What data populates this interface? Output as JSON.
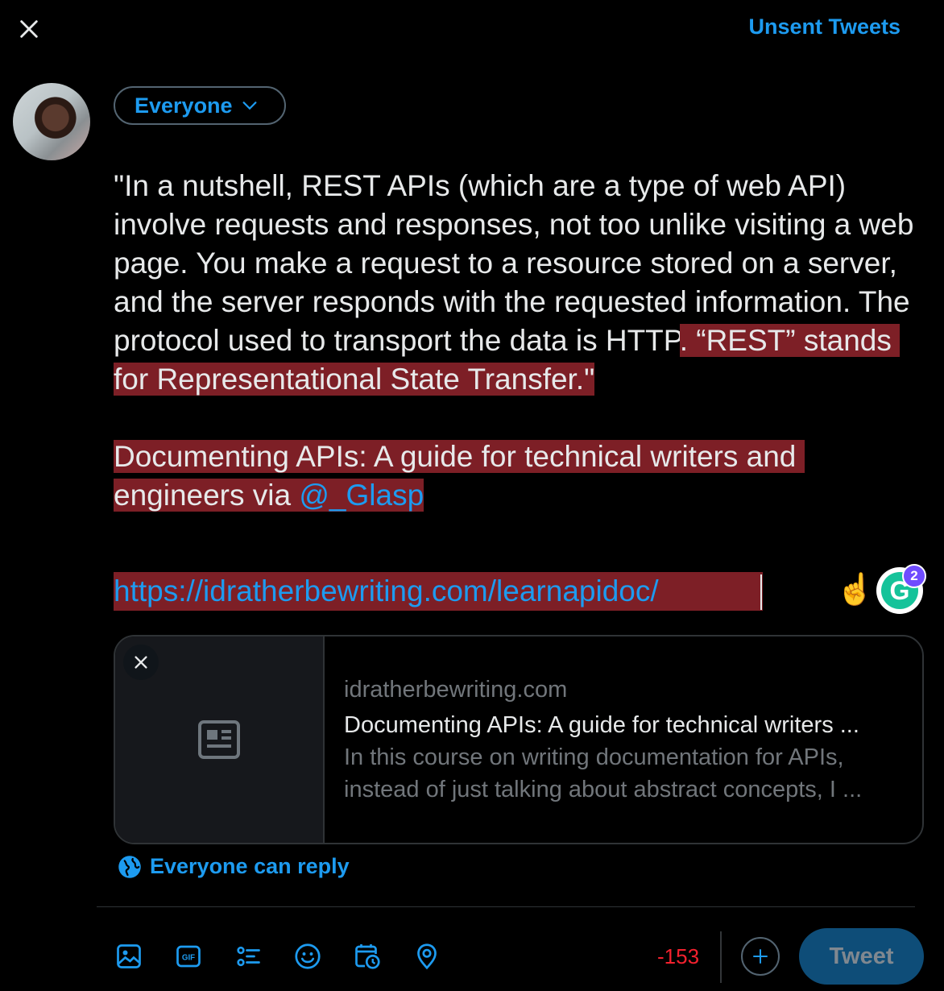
{
  "header": {
    "unsent_label": "Unsent Tweets"
  },
  "composer": {
    "audience_label": "Everyone",
    "text_plain": "\"In a nutshell, REST APIs (which are a type of web API) involve requests and responses, not too unlike visiting a web page. You make a request to a resource stored on a server, and the server responds with the requested information. The protocol used to transport the data is HTTP",
    "text_highlighted": ". “REST” stands for Representational State Transfer.\"",
    "source_line": "Documenting APIs: A guide for technical writers and engineers via ",
    "mention": "@_Glasp",
    "url": "https://idratherbewriting.com/learnapidoc/",
    "emoji": "☝️",
    "grammarly_count": "2",
    "grammarly_letter": "G"
  },
  "link_card": {
    "domain": "idratherbewriting.com",
    "title": "Documenting APIs: A guide for technical writers ...",
    "description_line1": "In this course on writing documentation for APIs,",
    "description_line2": "instead of just talking about abstract concepts, I ..."
  },
  "reply_setting": {
    "label": "Everyone can reply"
  },
  "toolbar": {
    "icons": [
      "image-icon",
      "gif-icon",
      "poll-icon",
      "emoji-icon",
      "schedule-icon",
      "location-icon"
    ],
    "gif_text": "GIF",
    "char_count": "-153",
    "tweet_label": "Tweet"
  },
  "colors": {
    "accent": "#1d9bf0",
    "highlight": "#7d1f26",
    "error": "#f4212e",
    "tweet_button_disabled": "#0e4d78"
  }
}
